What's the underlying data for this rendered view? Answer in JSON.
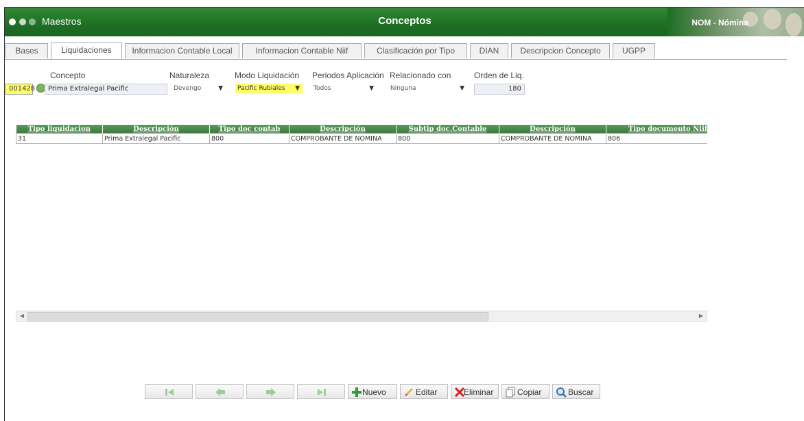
{
  "titlebar": {
    "app_label": "Maestros",
    "window_title": "Conceptos",
    "module_label": "NOM - Nómina",
    "dot_colors": [
      "#ffffff",
      "#cfd8cf",
      "#8fb38f"
    ]
  },
  "tabs": [
    {
      "label": "Bases",
      "active": false
    },
    {
      "label": "Liquidaciones",
      "active": true
    },
    {
      "label": "Informacion Contable Local",
      "active": false
    },
    {
      "label": "Informacion Contable Niif",
      "active": false
    },
    {
      "label": "Clasificación por Tipo",
      "active": false
    },
    {
      "label": "DIAN",
      "active": false
    },
    {
      "label": "Descripcion Concepto",
      "active": false
    },
    {
      "label": "UGPP",
      "active": false
    }
  ],
  "form": {
    "concepto_label": "Concepto",
    "concepto_code": "001428",
    "concepto_name": "Prima Extralegal Pacific",
    "naturaleza_label": "Naturaleza",
    "naturaleza_value": "Devengo",
    "modo_label": "Modo Liquidación",
    "modo_value": "Pacific Rubiales",
    "periodos_label": "Periodos Aplicación",
    "periodos_value": "Todos",
    "relacionado_label": "Relacionado con",
    "relacionado_value": "Ninguna",
    "orden_label": "Orden de Liq.",
    "orden_value": "180"
  },
  "grid": {
    "columns": [
      "Tipo liquidacion",
      "Descripción",
      "Tipo doc contab",
      "Descripción",
      "Subtip doc.Contable",
      "Descripción",
      "Tipo documento Niif"
    ],
    "rows": [
      [
        "31",
        "Prima Extralegal Pacific",
        "800",
        "COMPROBANTE DE NOMINA",
        "800",
        "COMPROBANTE DE NOMINA",
        "806"
      ]
    ]
  },
  "toolbar": {
    "nuevo": "Nuevo",
    "editar": "Editar",
    "eliminar": "Eliminar",
    "copiar": "Copiar",
    "buscar": "Buscar"
  },
  "colors": {
    "header_green": "#1f6e24",
    "grid_header_green": "#4a8a4c",
    "highlight_yellow": "#ffff66"
  }
}
